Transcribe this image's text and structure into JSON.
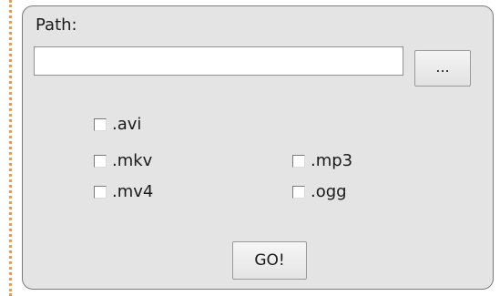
{
  "form": {
    "path_label": "Path:",
    "path_value": "",
    "browse_label": "...",
    "go_label": "GO!"
  },
  "extensions": [
    {
      "label": ".avi",
      "checked": false
    },
    {
      "label": ".mkv",
      "checked": false
    },
    {
      "label": ".mv4",
      "checked": false
    },
    {
      "label": ".mp3",
      "checked": false
    },
    {
      "label": ".ogg",
      "checked": false
    }
  ]
}
